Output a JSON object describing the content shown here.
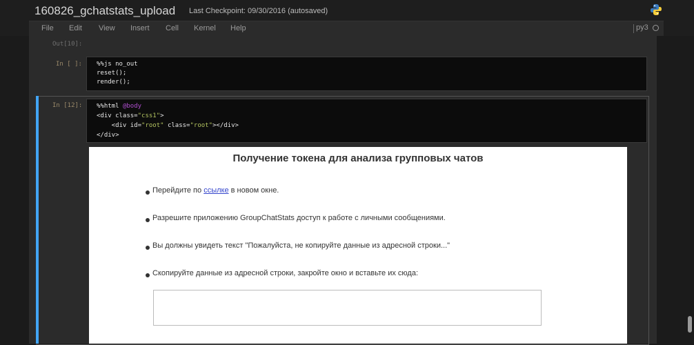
{
  "header": {
    "notebook_title": "160826_gchatstats_upload",
    "checkpoint_text": "Last Checkpoint: 09/30/2016 (autosaved)",
    "logo_icon": "python-logo-icon"
  },
  "menu": {
    "items": [
      "File",
      "Edit",
      "View",
      "Insert",
      "Cell",
      "Kernel",
      "Help"
    ],
    "kernel_name": "py3"
  },
  "cells": {
    "out10_prompt": "Out[10]:",
    "cell1": {
      "prompt": "In [ ]:",
      "lines": [
        "%%js no_out",
        "reset();",
        "render();"
      ]
    },
    "cell2": {
      "prompt": "In [12]:",
      "line1_magic": "%%html ",
      "line1_arg": "@body",
      "line2_pre": "<div class=",
      "line2_str": "\"css1\"",
      "line2_post": ">",
      "line3_pre": "    <div id=",
      "line3_str1": "\"root\"",
      "line3_mid": " class=",
      "line3_str2": "\"root\"",
      "line3_post": "></div>",
      "line4": "</div>"
    }
  },
  "output": {
    "heading": "Получение токена для анализа групповых чатов",
    "step1_before": "Перейдите по ",
    "step1_link": "ссылке",
    "step1_after": " в новом окне.",
    "step2": "Разрешите приложению GroupChatStats доступ к работе с личными сообщениями.",
    "step3": "Вы должны увидеть текст \"Пожалуйста, не копируйте данные из адресной строки...\"",
    "step4": "Скопируйте данные из адресной строки, закройте окно и вставьте их сюда:",
    "token_value": ""
  },
  "colors": {
    "selected_cell_accent": "#42a5f5",
    "link": "#3344cc"
  }
}
